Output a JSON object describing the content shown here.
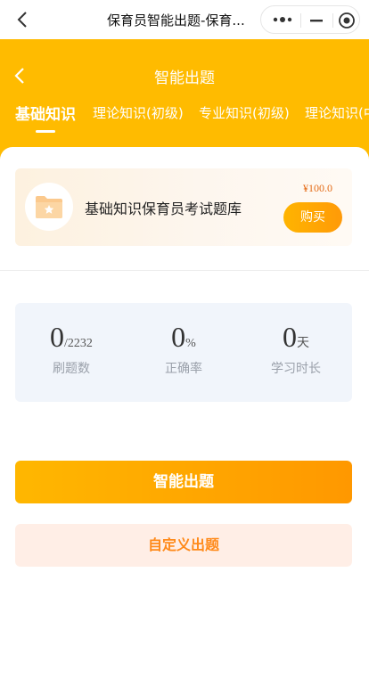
{
  "topbar": {
    "title": "保育员智能出题-保育...",
    "back_icon": "chevron-left-icon",
    "menu_icon": "more-dots-icon",
    "minimize_icon": "minus-icon",
    "close_icon": "target-icon"
  },
  "header": {
    "title": "智能出题",
    "back_icon": "chevron-left-icon",
    "bg_color": "#ffbb00"
  },
  "tabs": [
    {
      "label": "基础知识",
      "active": true
    },
    {
      "label": "理论知识(初级)",
      "active": false
    },
    {
      "label": "专业知识(初级)",
      "active": false
    },
    {
      "label": "理论知识(中级)",
      "active": false
    }
  ],
  "bank": {
    "icon": "folder-star-icon",
    "name": "基础知识保育员考试题库",
    "price": "¥100.0",
    "buy_label": "购买"
  },
  "stats": [
    {
      "value": "0",
      "unit": "/2232",
      "label": "刷题数"
    },
    {
      "value": "0",
      "unit": "%",
      "label": "正确率"
    },
    {
      "value": "0",
      "unit": "天",
      "label": "学习时长"
    }
  ],
  "actions": {
    "smart_label": "智能出题",
    "custom_label": "自定义出题"
  },
  "colors": {
    "accent": "#ffbb00",
    "price": "#e46b16",
    "custom_bg": "#ffeee6",
    "custom_text": "#ff8a1a"
  }
}
